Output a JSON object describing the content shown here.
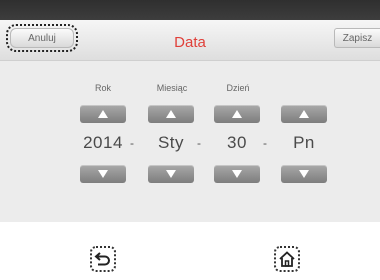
{
  "header": {
    "cancel_label": "Anuluj",
    "title": "Data",
    "save_label": "Zapisz"
  },
  "date_picker": {
    "columns": [
      {
        "label": "Rok",
        "value": "2014"
      },
      {
        "label": "Miesiąc",
        "value": "Sty"
      },
      {
        "label": "Dzień",
        "value": "30"
      },
      {
        "label": "",
        "value": "Pn"
      }
    ],
    "separator": "-"
  },
  "colors": {
    "title": "#e0403a",
    "arrow_button": "#8a8a8a",
    "topbar": "#333333"
  },
  "icons": {
    "back": "back-arrow-icon",
    "home": "home-icon"
  }
}
